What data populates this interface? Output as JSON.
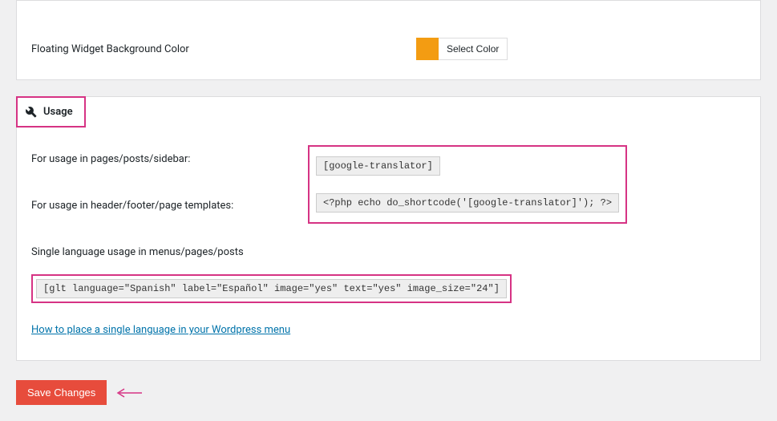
{
  "top_panel": {
    "bg_color_label": "Floating Widget Background Color",
    "select_color_label": "Select Color",
    "swatch_color": "#f39c12"
  },
  "usage_panel": {
    "tab_label": "Usage",
    "row_pages_label": "For usage in pages/posts/sidebar:",
    "row_pages_code": "[google-translator]",
    "row_templates_label": "For usage in header/footer/page templates:",
    "row_templates_code": "<?php echo do_shortcode('[google-translator]'); ?>",
    "single_lang_label": "Single language usage in menus/pages/posts",
    "single_lang_code": "[glt language=\"Spanish\" label=\"Español\" image=\"yes\" text=\"yes\" image_size=\"24\"]",
    "help_link_label": "How to place a single language in your Wordpress menu"
  },
  "save_button_label": "Save Changes"
}
